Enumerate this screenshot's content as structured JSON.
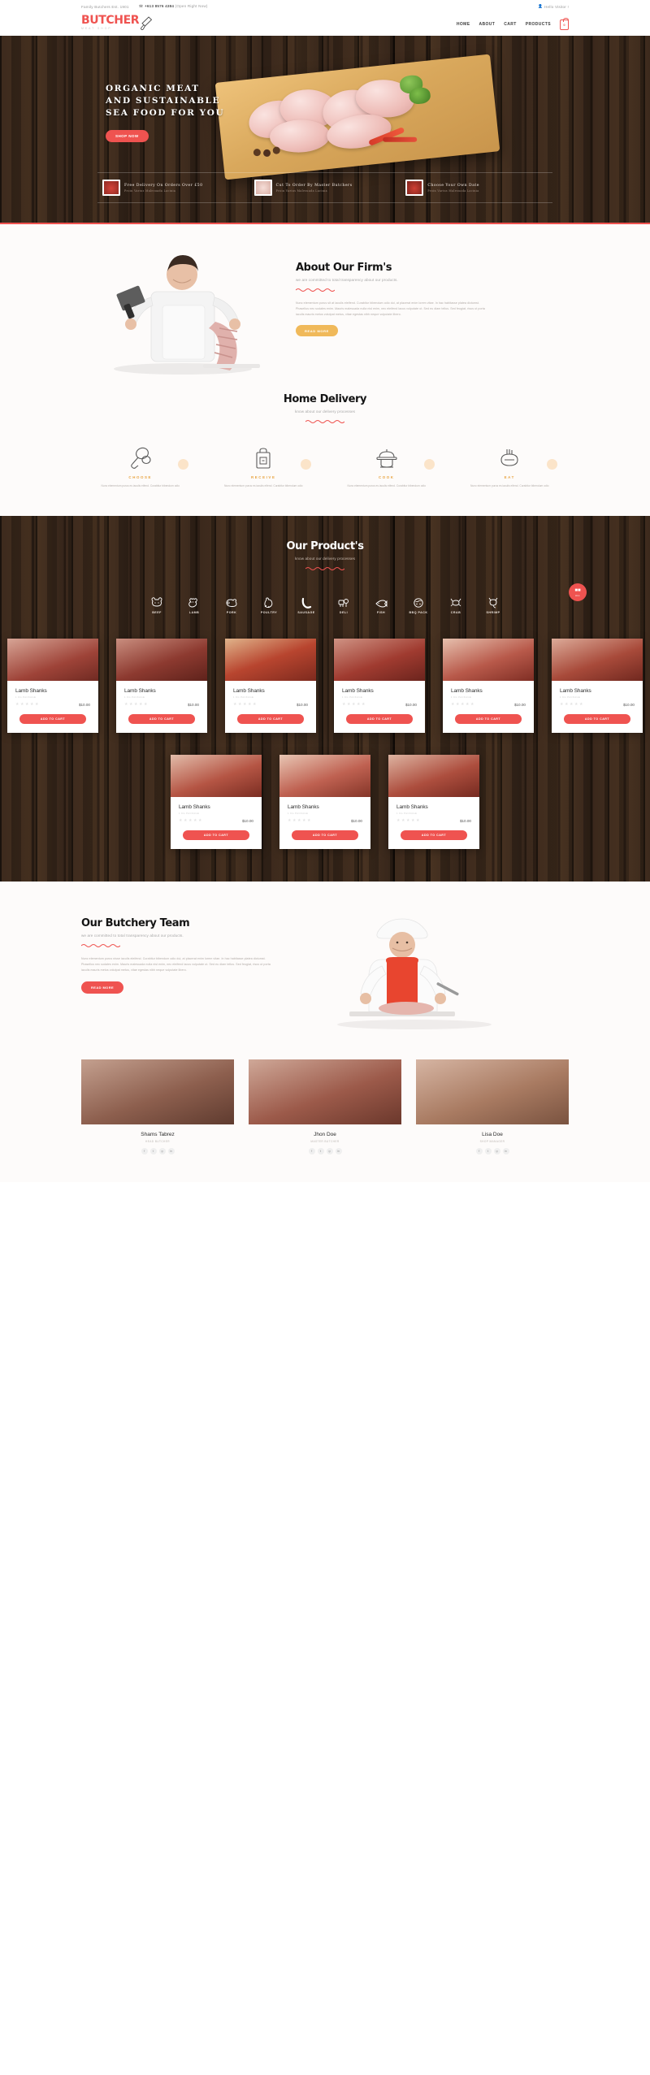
{
  "topbar": {
    "tagline": "Family Butchers Est. 1901",
    "phone_icon": "phone-icon",
    "phone": "+613 8576 4384",
    "hours": "(Open Right Now)",
    "user_icon": "user-icon",
    "greeting": "Hello Visitor !"
  },
  "header": {
    "logo": "BUTCHER",
    "logo_sub": "MEAT SHOP",
    "cleaver_icon": "cleaver-icon",
    "nav": [
      {
        "label": "HOME"
      },
      {
        "label": "ABOUT"
      },
      {
        "label": "CART"
      },
      {
        "label": "PRODUCTS"
      }
    ],
    "cart_icon": "shopping-bag-icon",
    "cart_count": "0"
  },
  "hero": {
    "title_line1": "ORGANIC  MEAT",
    "title_line2": "AND  SUSTAINABLE",
    "title_line3": "SEA  FOOD  FOR  YOU",
    "cta": "SHOP NOW",
    "features": [
      {
        "title": "Free Delivery On Orders Over £50",
        "subtitle": "Proin Varius Malesuada Lacinia",
        "icon": "raw-meat-thumb"
      },
      {
        "title": "Cut To Order By Master Butchers",
        "subtitle": "Proin Varius Malesuada Lacinia",
        "icon": "poultry-thumb"
      },
      {
        "title": "Choose Your Own Date",
        "subtitle": "Proin Varius Malesuada Lacinia",
        "icon": "steak-thumb"
      }
    ]
  },
  "about": {
    "heading": "About Our Firm's",
    "subheading": "we are committed to total transparency about our products.",
    "paragraph": "Nunc elementum purus sit at iaculis eleifend. Curabitur bibendum odio dui, at placerat enim lorem vitae. In hac habitasse platea dictumst. Phasellus nec sodales enim. Mauris malesuada nulla nisl enim, nec eleifend lacus vulputate ut. Sed eu diam tellus. Sed feugiat, risus ut porta iaculis mauris metus volutpat metus, vitae egestas nibh neque vulputate libero.",
    "cta": "READ MORE",
    "image_alt": "butcher-with-cleaver-photo"
  },
  "delivery": {
    "heading": "Home Delivery",
    "subheading": "know about our delivery processes",
    "steps": [
      {
        "icon": "drumstick-icon",
        "title": "CHOOSE",
        "text": "Nunc elementum purus es iaculis eifend. Curabitur bibendum odio"
      },
      {
        "icon": "delivery-bag-icon",
        "title": "RECEIVE",
        "text": "Nunc elementum purus es iaculis eifend. Curabitur bibendum odio"
      },
      {
        "icon": "cooking-pot-icon",
        "title": "COOK",
        "text": "Nunc elementum purus es iaculis eifend. Curabitur bibendum odio"
      },
      {
        "icon": "meal-plate-icon",
        "title": "EAT",
        "text": "Nunc elementum purus es iaculis eifend. Curabitur bibendum odio"
      }
    ]
  },
  "products": {
    "heading": "Our Product's",
    "subheading": "know about our delivery processes",
    "all_button_icon": "grid-icon",
    "all_button_label": "ALL",
    "categories": [
      {
        "label": "BEEF",
        "icon": "cow-icon"
      },
      {
        "label": "LAMB",
        "icon": "sheep-icon"
      },
      {
        "label": "PORK",
        "icon": "pig-icon"
      },
      {
        "label": "POULTRY",
        "icon": "chicken-icon"
      },
      {
        "label": "SAUSAGE",
        "icon": "sausage-icon"
      },
      {
        "label": "DELI",
        "icon": "deli-icon"
      },
      {
        "label": "FISH",
        "icon": "fish-icon"
      },
      {
        "label": "BBQ PACK",
        "icon": "bbq-icon"
      },
      {
        "label": "CRAB",
        "icon": "crab-icon"
      },
      {
        "label": "SHRIMP",
        "icon": "shrimp-icon"
      }
    ],
    "add_to_cart_label": "ADD TO CART",
    "items": [
      {
        "name": "Lamb Shanks",
        "sku": "1 KG PACKAGE",
        "price": "$10.00",
        "rating": 4,
        "image": "lamb-chop-photo"
      },
      {
        "name": "Lamb Shanks",
        "sku": "1 KG PACKAGE",
        "price": "$10.00",
        "rating": 4,
        "image": "lamb-rack-photo"
      },
      {
        "name": "Lamb Shanks",
        "sku": "1 KG PACKAGE",
        "price": "$10.00",
        "rating": 4,
        "image": "diced-lamb-photo"
      },
      {
        "name": "Lamb Shanks",
        "sku": "1 KG PACKAGE",
        "price": "$10.00",
        "rating": 4,
        "image": "lamb-steak-photo"
      },
      {
        "name": "Lamb Shanks",
        "sku": "1 KG PACKAGE",
        "price": "$10.00",
        "rating": 4,
        "image": "lamb-loin-photo"
      },
      {
        "name": "Lamb Shanks",
        "sku": "1 KG PACKAGE",
        "price": "$10.00",
        "rating": 4,
        "image": "lamb-ribs-photo"
      },
      {
        "name": "Lamb Shanks",
        "sku": "1 KG PACKAGE",
        "price": "$10.00",
        "rating": 4,
        "image": "lamb-cut-photo"
      },
      {
        "name": "Lamb Shanks",
        "sku": "1 KG PACKAGE",
        "price": "$10.00",
        "rating": 4,
        "image": "lamb-fillet-photo"
      },
      {
        "name": "Lamb Shanks",
        "sku": "1 KG PACKAGE",
        "price": "$10.00",
        "rating": 4,
        "image": "lamb-roast-photo"
      }
    ]
  },
  "team": {
    "heading": "Our Butchery Team",
    "subheading": "we are committed to total transparency about our products.",
    "paragraph": "Nunc elementum purus nisse iaculis eleifend. Curabitur bibendum odio dui, at placerat enim lorem vitae. In hac habitasse platea dictumst. Phasellus nec sodales enim. Mauris malesuada nulla nisl enim, nec eleifend lacus vulputate ut. Sed eu diam tellus. Sed feugiat, risus ut porta iaculis mauris metus volutpat metus, vitae egestas nibh neque vulputate libero.",
    "cta": "READ MORE",
    "hero_image_alt": "chef-cutting-meat-photo",
    "members": [
      {
        "name": "Shams Tabrez",
        "role": "HEAD BUTCHER",
        "image": "butcher-portrait-1",
        "socials": [
          "f",
          "t",
          "g",
          "in"
        ]
      },
      {
        "name": "Jhon Doe",
        "role": "MASTER BUTCHER",
        "image": "butcher-portrait-2",
        "socials": [
          "f",
          "t",
          "g",
          "in"
        ]
      },
      {
        "name": "Lisa Doe",
        "role": "SHOP MANAGER",
        "image": "butcher-portrait-3",
        "socials": [
          "f",
          "t",
          "g",
          "in"
        ]
      }
    ]
  },
  "colors": {
    "accent_red": "#ef5350",
    "accent_amber": "#f0b95a",
    "wood_dark": "#2e2119",
    "text_dark": "#141414"
  }
}
